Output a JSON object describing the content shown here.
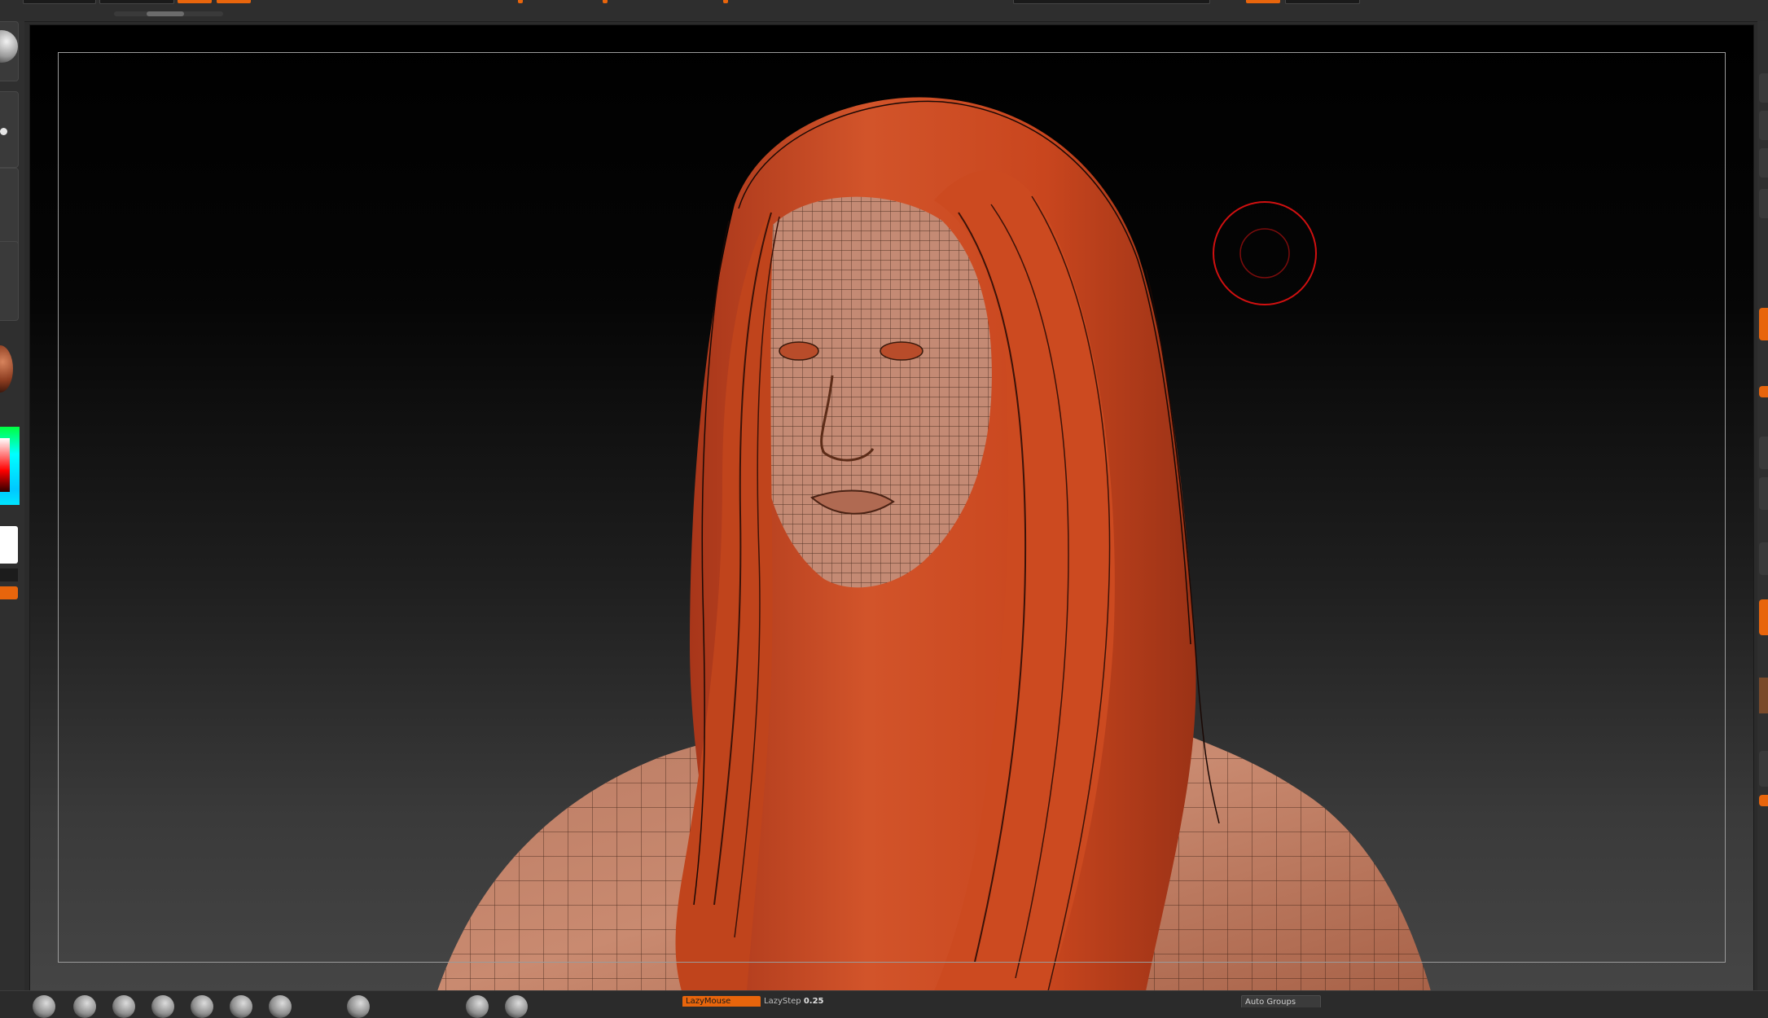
{
  "app": "ZBrush",
  "bottom_toolbar": {
    "lazymouse_label": "LazyMouse",
    "lazystep_label": "LazyStep",
    "lazystep_value": "0.25",
    "auto_groups_label": "Auto Groups"
  },
  "colors": {
    "accent": "#e8650c",
    "ui_background": "#2b2b2b",
    "canvas_top": "#000000",
    "canvas_bottom": "#454545",
    "model_skin": "#c98a70",
    "model_hair": "#c9461e",
    "brush_cursor": "#d01010"
  },
  "icons": {
    "brush": "brush-sphere-icon",
    "material": "material-sphere-icon",
    "cursor": "draw-size-cursor-icon"
  }
}
